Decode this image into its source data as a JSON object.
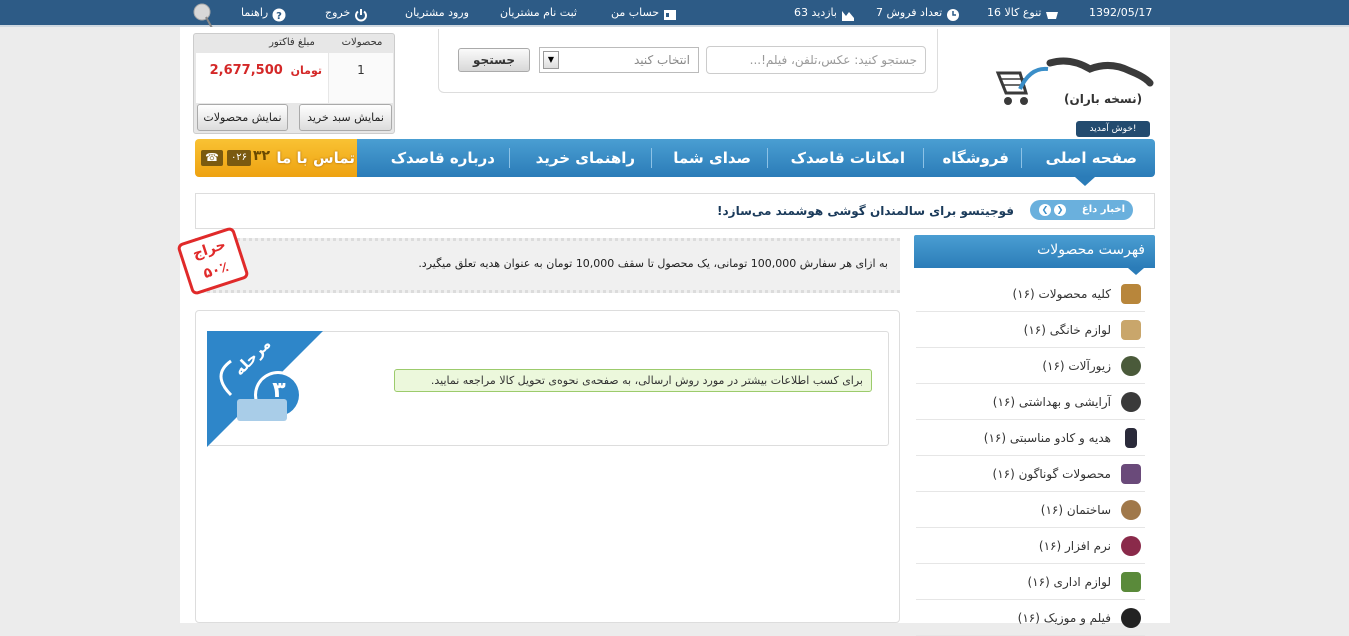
{
  "topbar": {
    "date": "1392/05/17",
    "variety_label": "تنوع کالا 16",
    "sales_label": "تعداد فروش 7",
    "visits_label": "بازدید 63",
    "account_label": "حساب من",
    "register_label": "ثبت نام مشتریان",
    "login_label": "ورود مشتریان",
    "logout_label": "خروج",
    "help_label": "راهنما"
  },
  "logo": {
    "tagline": "(نسخه باران)"
  },
  "welcome": "خوش آمدید!",
  "search": {
    "placeholder": "جستجو کنید: عکس،تلفن، فیلم!...",
    "select_value": "انتخاب کنید",
    "button_label": "جستجو"
  },
  "cart": {
    "col_products": "محصولات",
    "col_amount": "مبلغ فاکتور",
    "count": "1",
    "amount": "2,677,500",
    "currency": "تومان",
    "show_cart_label": "نمایش سبد خرید",
    "show_products_label": "نمایش محصولات"
  },
  "nav": {
    "items": [
      "صفحه اصلی",
      "فروشگاه",
      "امکانات قاصدک",
      "صدای شما",
      "راهنمای خرید",
      "درباره قاصدک"
    ],
    "contact_label": "تماس با ما",
    "phone_code": "۰۲۶",
    "phone_partial": "۳۲"
  },
  "news": {
    "tag": "اخبار داغ",
    "headline": "فوجیتسو برای سالمندان گوشی هوشمند می‌سازد!"
  },
  "promo": {
    "text": "به ازای هر سفارش 100,000 تومانی، یک محصول تا سقف 10,000 تومان به عنوان هدیه تعلق میگیرد.",
    "stamp_line1": "حراج",
    "stamp_line2": "۵۰٪"
  },
  "step": {
    "label": "مرحله",
    "number": "۳",
    "notice": "برای کسب اطلاعات بیشتر در مورد روش ارسالی، به صفحه‌ی نحوه‌ی تحویل کالا مراجعه نمایید."
  },
  "sidebar": {
    "title": "فهرست محصولات",
    "categories": [
      {
        "label": "کلیه محصولات (۱۶)",
        "icon": "box-icon",
        "color": "#b8863b"
      },
      {
        "label": "لوازم خانگی (۱۶)",
        "icon": "appliance-icon",
        "color": "#c9a66b"
      },
      {
        "label": "زیورآلات (۱۶)",
        "icon": "jewelry-icon",
        "color": "#4a5a3a"
      },
      {
        "label": "آرایشی و بهداشتی (۱۶)",
        "icon": "cosmetics-icon",
        "color": "#3a3a3a"
      },
      {
        "label": "هدیه و کادو مناسبتی (۱۶)",
        "icon": "gift-icon",
        "color": "#2a2a3a"
      },
      {
        "label": "محصولات گوناگون (۱۶)",
        "icon": "misc-icon",
        "color": "#6a4a7a"
      },
      {
        "label": "ساختمان (۱۶)",
        "icon": "building-icon",
        "color": "#a0784a"
      },
      {
        "label": "نرم افزار (۱۶)",
        "icon": "software-icon",
        "color": "#8a2a4a"
      },
      {
        "label": "لوازم اداری (۱۶)",
        "icon": "office-icon",
        "color": "#5a8a3a"
      },
      {
        "label": "فیلم و موزیک (۱۶)",
        "icon": "film-icon",
        "color": "#222222"
      }
    ]
  }
}
